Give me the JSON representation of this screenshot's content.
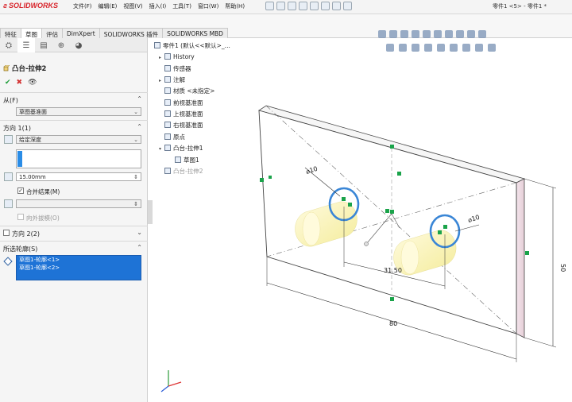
{
  "app": {
    "logo_text": "SOLIDWORKS",
    "window_title": "零件1 <5> - 零件1 *",
    "menus": [
      "文件(F)",
      "编辑(E)",
      "视图(V)",
      "插入(I)",
      "工具(T)",
      "窗口(W)",
      "帮助(H)"
    ]
  },
  "command_tabs": [
    "特征",
    "草图",
    "评估",
    "DimXpert",
    "SOLIDWORKS 插件",
    "SOLIDWORKS MBD"
  ],
  "active_tab": "草图",
  "property_manager": {
    "title": "凸台-拉伸2",
    "from": {
      "label": "从(F)",
      "value": "草图基准面"
    },
    "direction1": {
      "label": "方向 1(1)",
      "end_condition": "给定深度",
      "depth": "15.00mm",
      "merge_result_label": "合并结果(M)",
      "merge_result_checked": true,
      "draft_outward_label": "向外拔模(O)"
    },
    "direction2": {
      "label": "方向 2(2)"
    },
    "selected_contours": {
      "label": "所选轮廓(S)",
      "items": [
        "草图1-轮廓<1>",
        "草图1-轮廓<2>"
      ]
    }
  },
  "feature_tree": {
    "root": "零件1 (默认<<默认>_...",
    "items": [
      "History",
      "传感器",
      "注解",
      "材质 <未指定>",
      "前视基准面",
      "上视基准面",
      "右视基准面",
      "原点",
      "凸台-拉伸1",
      "草图1",
      "凸台-拉伸2"
    ]
  },
  "drawing": {
    "dims": {
      "width": "80",
      "height": "50",
      "spacing": "31.50",
      "dia_left": "⌀10",
      "dia_right": "⌀10"
    }
  },
  "colors": {
    "accent": "#1e73d6",
    "ok": "#1f9d3a",
    "cancel": "#d32f2f",
    "logo": "#d8232a"
  }
}
